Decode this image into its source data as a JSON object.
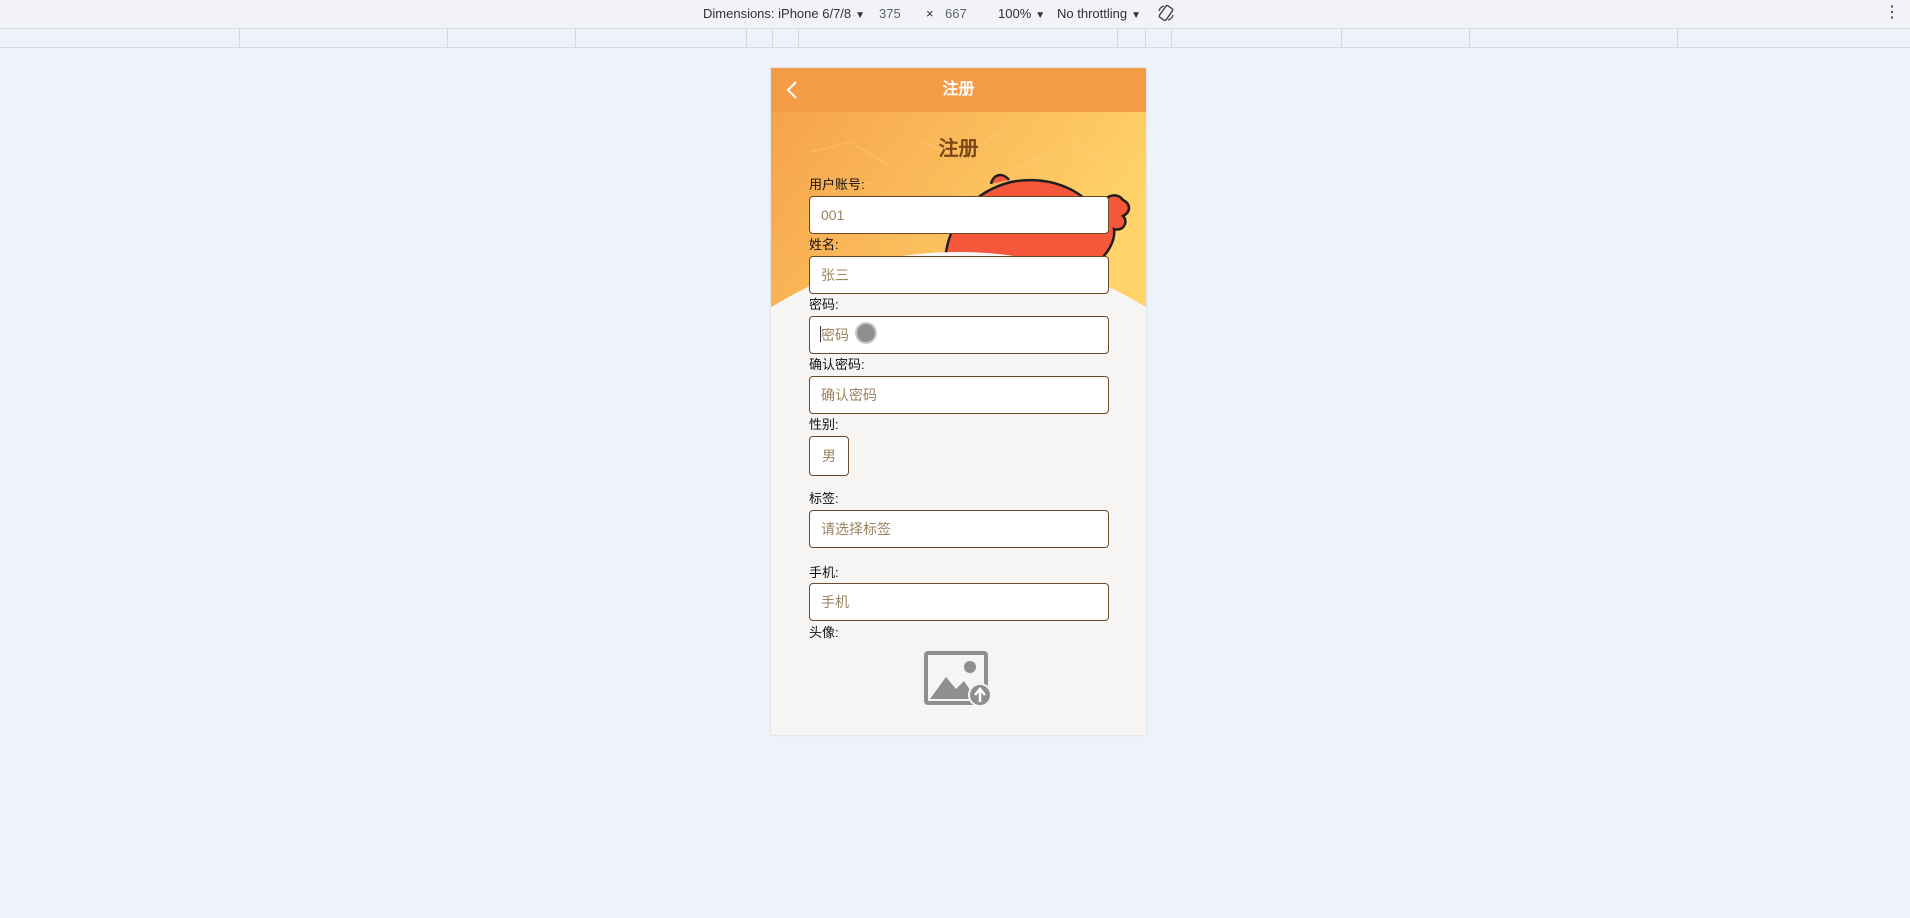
{
  "devtools": {
    "dimensions_label": "Dimensions: iPhone 6/7/8",
    "width": "375",
    "times": "×",
    "height": "667",
    "zoom": "100%",
    "throttling": "No throttling"
  },
  "navbar": {
    "title": "注册"
  },
  "form": {
    "title": "注册",
    "account_label": "用户账号:",
    "account_value": "001",
    "name_label": "姓名:",
    "name_placeholder": "张三",
    "password_label": "密码:",
    "password_placeholder": "密码",
    "confirm_label": "确认密码:",
    "confirm_placeholder": "确认密码",
    "gender_label": "性别:",
    "gender_value": "男",
    "tags_label": "标签:",
    "tags_placeholder": "请选择标签",
    "phone_label": "手机:",
    "phone_placeholder": "手机",
    "avatar_label": "头像:"
  },
  "colors": {
    "navbar": "#f39b45",
    "border": "#6e4a25",
    "page_bg": "#eef2f9",
    "form_bg": "#f6f5f4"
  }
}
